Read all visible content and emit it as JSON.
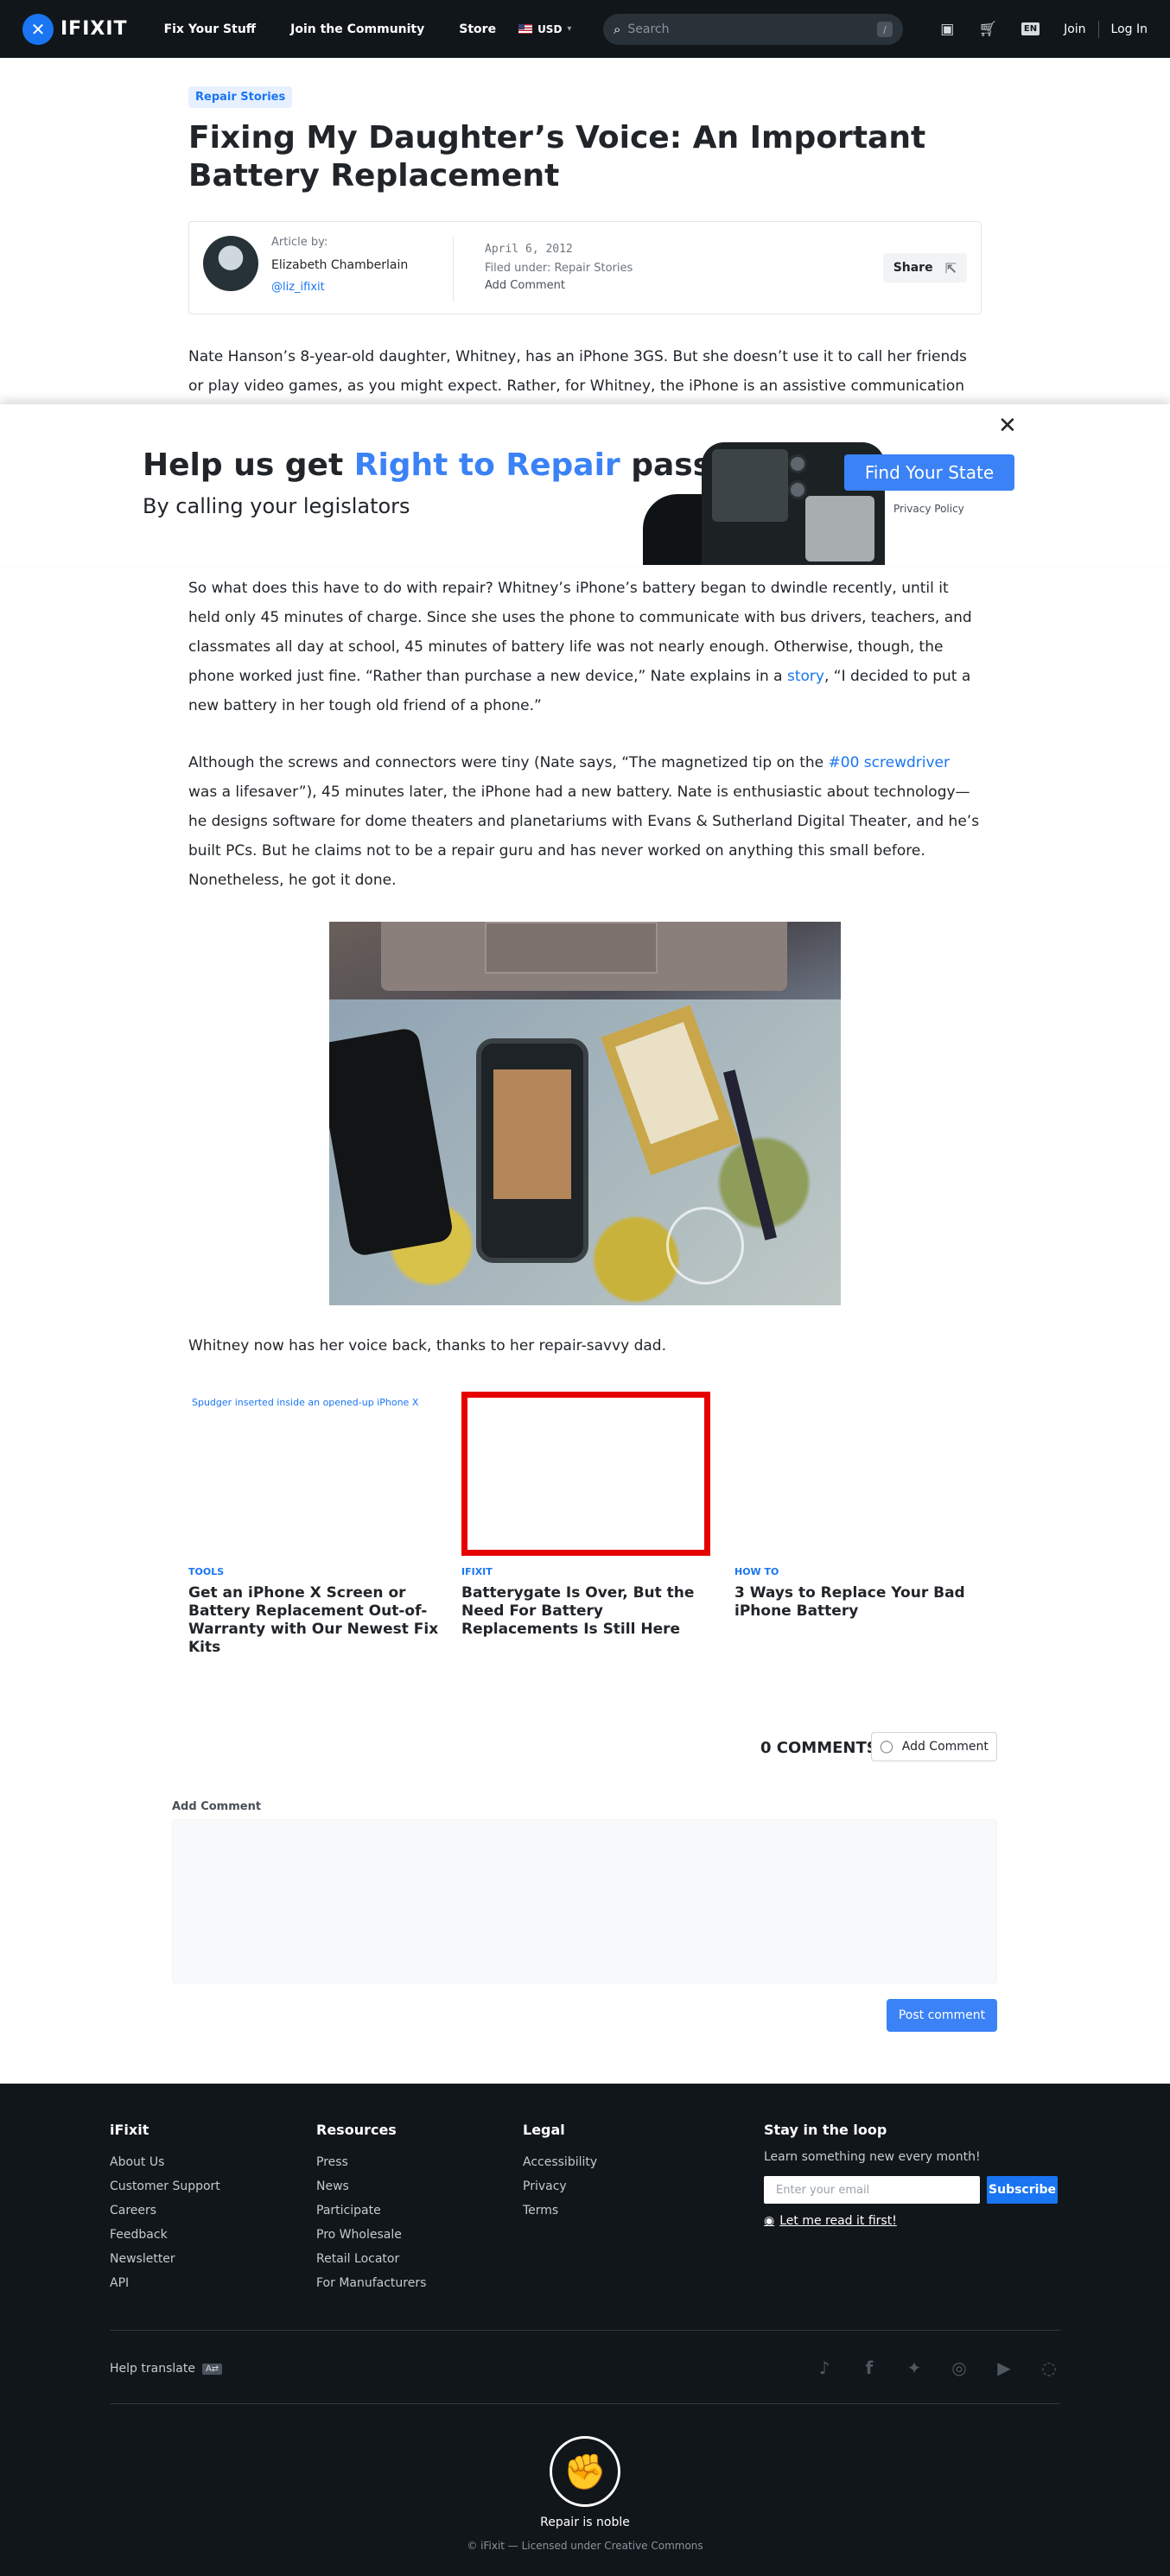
{
  "header": {
    "logo_text": "IFIXIT",
    "nav": [
      "Fix Your Stuff",
      "Join the Community",
      "Store"
    ],
    "currency": "USD",
    "search_placeholder": "Search",
    "search_shortcut": "/",
    "lang": "EN",
    "join": "Join",
    "login": "Log In"
  },
  "article": {
    "tag": "Repair Stories",
    "title": "Fixing My Daughter’s Voice: An Important Battery Replacement",
    "author_label": "Article by:",
    "author_name": "Elizabeth Chamberlain",
    "author_handle": "@liz_ifixit",
    "date": "April 6, 2012",
    "filed_label": "Filed under:",
    "filed_value": "Repair Stories",
    "add_comment": "Add Comment",
    "share": "Share",
    "p1": "Nate Hanson’s 8-year-old daughter, Whitney, has an iPhone 3GS. But she doesn’t use it to call her friends or play video games, as you might expect. Rather, for Whitney, the iPhone is an assistive communication device.",
    "p2_a": "So what does this have to do with repair? Whitney’s iPhone’s battery began to dwindle recently, until it held only 45 minutes of charge. Since she uses the phone to communicate with bus drivers, teachers, and classmates all day at school, 45 minutes of battery life was not nearly enough. Otherwise, though, the phone worked just fine. “Rather than purchase a new device,” Nate explains in a ",
    "p2_link": "story",
    "p2_b": ", “I decided to put a new battery in her tough old friend of a phone.”",
    "p3_a": "Although the screws and connectors were tiny (Nate says, “The magnetized tip on the ",
    "p3_link": "#00 screwdriver",
    "p3_b": " was a lifesaver”), 45 minutes later, the iPhone had a new battery. Nate is enthusiastic about technology—he designs software for dome theaters and planetariums with Evans & Sutherland Digital Theater, and he’s built PCs. But he claims not to be a repair guru and has never worked on anything this small before. Nonetheless, he got it done.",
    "p4": "Whitney now has her voice back, thanks to her repair-savvy dad."
  },
  "overlay": {
    "title_a": "Help us get ",
    "title_highlight": "Right to Repair",
    "title_b": " passed",
    "subtitle": "By calling your legislators",
    "button": "Find Your State",
    "privacy": "Privacy Policy",
    "close": "✕"
  },
  "related": [
    {
      "img_alt": "Spudger inserted inside an opened-up iPhone X",
      "tag": "TOOLS",
      "title": "Get an iPhone X Screen or Battery Replacement Out-of-Warranty with Our Newest Fix Kits"
    },
    {
      "img_alt": "",
      "tag": "IFIXIT",
      "title": "Batterygate Is Over, But the Need For Battery Replacements Is Still Here"
    },
    {
      "img_alt": "",
      "tag": "HOW TO",
      "title": "3 Ways to Replace Your Bad iPhone Battery"
    }
  ],
  "comments": {
    "count_label": "0 COMMENTS",
    "add_button": "Add Comment",
    "form_label": "Add Comment",
    "post_button": "Post comment"
  },
  "footer": {
    "col1": {
      "title": "iFixit",
      "items": [
        "About Us",
        "Customer Support",
        "Careers",
        "Feedback",
        "Newsletter",
        "API"
      ]
    },
    "col2": {
      "title": "Resources",
      "items": [
        "Press",
        "News",
        "Participate",
        "Pro Wholesale",
        "Retail Locator",
        "For Manufacturers"
      ]
    },
    "col3": {
      "title": "Legal",
      "items": [
        "Accessibility",
        "Privacy",
        "Terms"
      ]
    },
    "newsletter": {
      "title": "Stay in the loop",
      "desc": "Learn something new every month!",
      "placeholder": "Enter your email",
      "subscribe": "Subscribe",
      "read_first": "Let me read it first!"
    },
    "help_translate": "Help translate",
    "tagline": "Repair is noble",
    "copyright": "© iFixit — Licensed under Creative Commons"
  },
  "colors": {
    "accent": "#1975f2",
    "overlay_accent": "#3b82f6",
    "nav_bg": "#11161a",
    "placeholder_border": "#e60000"
  }
}
